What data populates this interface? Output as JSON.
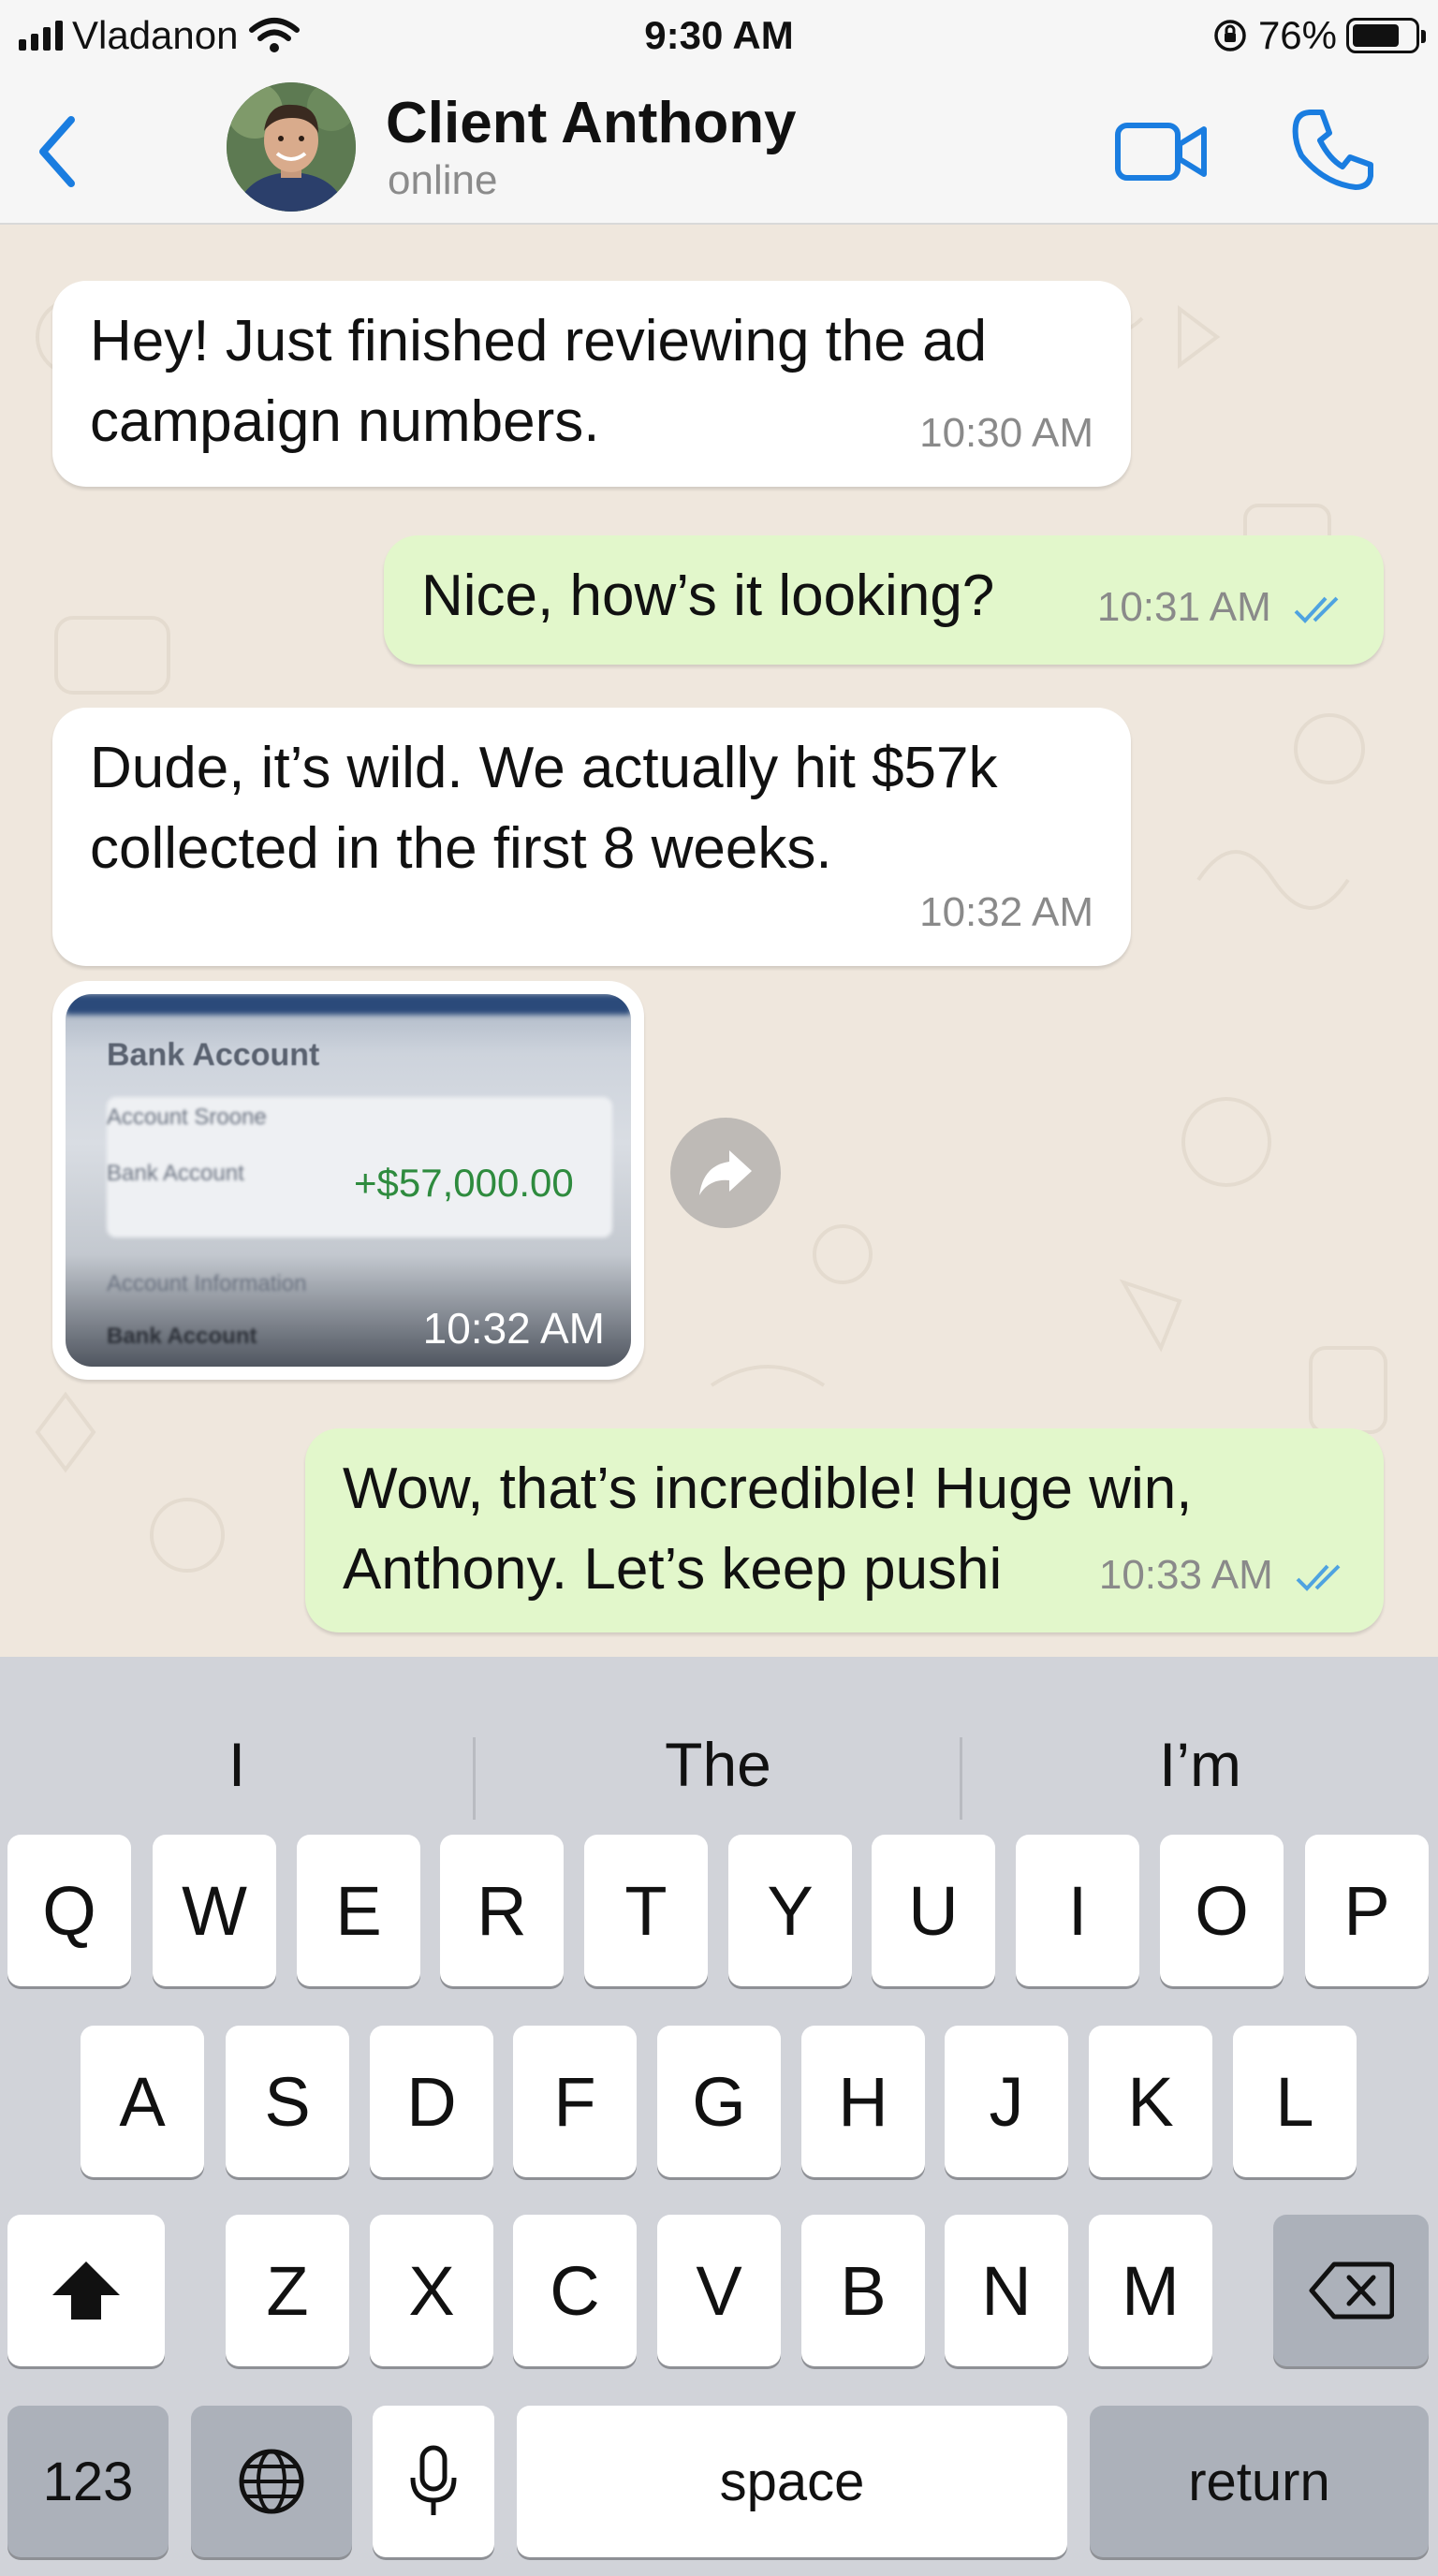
{
  "status_bar": {
    "carrier": "Vladanon",
    "time": "9:30 AM",
    "battery_percent": "76%",
    "battery_level": 0.76,
    "icons": [
      "signal-icon",
      "wifi-icon",
      "orientation-lock-icon",
      "battery-icon"
    ]
  },
  "header": {
    "contact_name": "Client Anthony",
    "contact_status": "online",
    "icons": [
      "back-chevron-icon",
      "video-camera-icon",
      "phone-icon"
    ],
    "accent_color": "#1a7de0"
  },
  "messages": [
    {
      "direction": "incoming",
      "text_lines": [
        "Hey! Just finished reviewing the ad",
        "campaign numbers."
      ],
      "time": "10:30 AM"
    },
    {
      "direction": "outgoing",
      "text_lines": [
        "Nice, how’s it looking?"
      ],
      "time": "10:31 AM",
      "read": true
    },
    {
      "direction": "incoming",
      "text_lines": [
        "Dude, it’s wild. We actually hit $57k",
        "collected in the first 8 weeks."
      ],
      "time": "10:32 AM"
    },
    {
      "direction": "incoming",
      "type": "image",
      "time": "10:32 AM",
      "image": {
        "title": "Bank Account",
        "subtitle": "Account Sroone",
        "row_label": "Bank Account",
        "amount": "+$57,000.00",
        "section_label": "Account Information",
        "bottom_label": "Bank Account"
      }
    },
    {
      "direction": "outgoing",
      "text_lines": [
        "Wow, that’s incredible! Huge win,",
        "Anthony. Let’s keep pushi"
      ],
      "time": "10:33 AM",
      "read": true
    }
  ],
  "colors": {
    "incoming_bubble": "#ffffff",
    "outgoing_bubble": "#e2f7cb",
    "chat_background": "#efe7dd",
    "read_ticks": "#4fa3e0",
    "amount_green": "#2e8b3e"
  },
  "keyboard": {
    "suggestions": [
      "I",
      "The",
      "I’m"
    ],
    "row1": [
      "Q",
      "W",
      "E",
      "R",
      "T",
      "Y",
      "U",
      "I",
      "O",
      "P"
    ],
    "row2": [
      "A",
      "S",
      "D",
      "F",
      "G",
      "H",
      "J",
      "K",
      "L"
    ],
    "row3": [
      "Z",
      "X",
      "C",
      "V",
      "B",
      "N",
      "M"
    ],
    "numbers_label": "123",
    "space_label": "space",
    "return_label": "return",
    "icons": [
      "shift-icon",
      "backspace-icon",
      "globe-icon",
      "microphone-icon"
    ]
  }
}
